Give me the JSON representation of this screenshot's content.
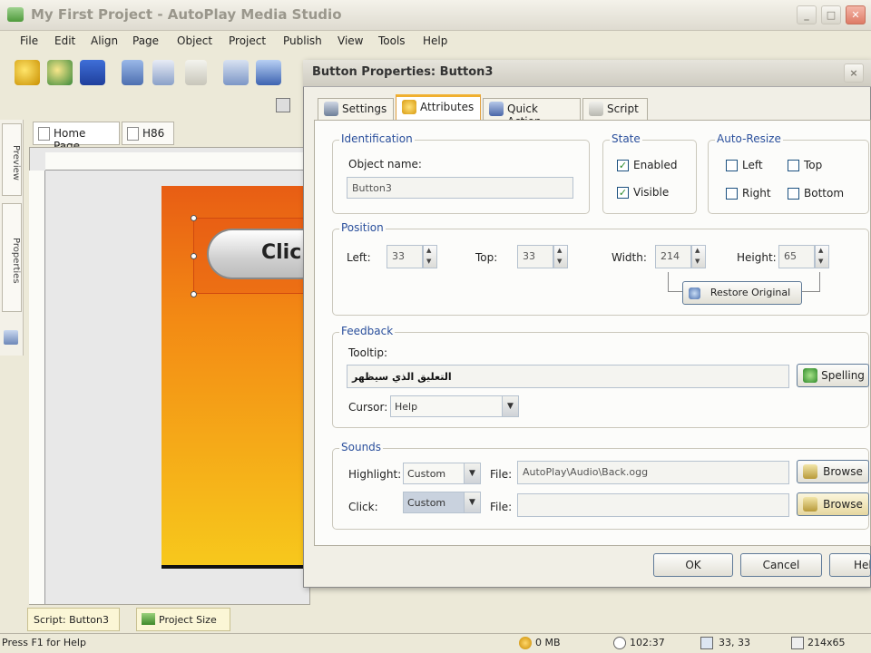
{
  "window": {
    "title": "My First Project - AutoPlay Media Studio",
    "min": "_",
    "max": "□",
    "close": "✕"
  },
  "menu": [
    "File",
    "Edit",
    "Align",
    "Page",
    "Object",
    "Project",
    "Publish",
    "View",
    "Tools",
    "Help"
  ],
  "side_tabs": [
    "Preview",
    "Properties"
  ],
  "doc_tabs": [
    "Home Page",
    "H86"
  ],
  "canvas": {
    "button_text": "Click"
  },
  "bottom_panel": {
    "script_label": "Script: Button3",
    "project_size_label": "Project Size"
  },
  "status": {
    "help": "Press F1 for Help",
    "memory": "0 MB",
    "time": "102:37",
    "coords": "33, 33",
    "size": "214x65"
  },
  "dialog": {
    "title": "Button Properties: Button3",
    "tabs": [
      "Settings",
      "Attributes",
      "Quick Action",
      "Script"
    ],
    "active_tab": "Attributes",
    "identification": {
      "legend": "Identification",
      "object_name_label": "Object name:",
      "object_name": "Button3"
    },
    "state": {
      "legend": "State",
      "enabled_label": "Enabled",
      "enabled": true,
      "visible_label": "Visible",
      "visible": true
    },
    "auto_resize": {
      "legend": "Auto-Resize",
      "left": "Left",
      "top": "Top",
      "right": "Right",
      "bottom": "Bottom"
    },
    "position": {
      "legend": "Position",
      "left_label": "Left:",
      "left": "33",
      "top_label": "Top:",
      "top": "33",
      "width_label": "Width:",
      "width": "214",
      "height_label": "Height:",
      "height": "65",
      "restore_label": "Restore Original"
    },
    "feedback": {
      "legend": "Feedback",
      "tooltip_label": "Tooltip:",
      "tooltip": "التعليق الذي سيظهر",
      "spelling_label": "Spelling",
      "cursor_label": "Cursor:",
      "cursor": "Help"
    },
    "sounds": {
      "legend": "Sounds",
      "highlight_label": "Highlight:",
      "highlight": "Custom",
      "highlight_file_label": "File:",
      "highlight_file": "AutoPlay\\Audio\\Back.ogg",
      "click_label": "Click:",
      "click": "Custom",
      "click_file_label": "File:",
      "click_file": "",
      "browse_label": "Browse"
    },
    "buttons": {
      "ok": "OK",
      "cancel": "Cancel",
      "help": "Help"
    }
  }
}
